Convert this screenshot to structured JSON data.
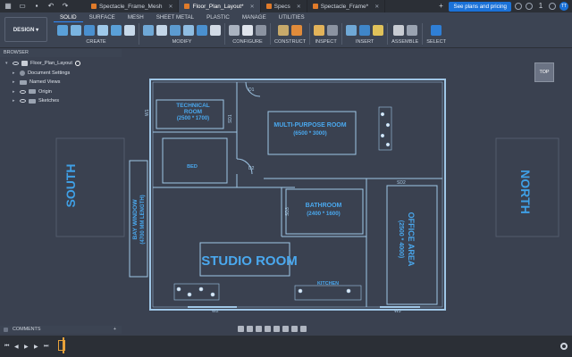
{
  "titlebar": {
    "tabs": [
      {
        "label": "Spectacle_Frame_Mesh",
        "active": false
      },
      {
        "label": "Floor_Plan_Layout*",
        "active": true
      },
      {
        "label": "Specs",
        "active": false
      },
      {
        "label": "Spectacle_Frame*",
        "active": false
      }
    ],
    "plans_button": "See plans and pricing",
    "notification_count": "1",
    "user_initials": "TT"
  },
  "toolbar": {
    "workspace": "DESIGN",
    "tabs": [
      "SOLID",
      "SURFACE",
      "MESH",
      "SHEET METAL",
      "PLASTIC",
      "MANAGE",
      "UTILITIES"
    ],
    "active_tab": "SOLID",
    "groups": [
      "CREATE",
      "MODIFY",
      "CONFIGURE",
      "CONSTRUCT",
      "INSPECT",
      "INSERT",
      "ASSEMBLE",
      "SELECT"
    ]
  },
  "browser": {
    "header": "BROWSER",
    "root": "Floor_Plan_Layout",
    "items": [
      {
        "label": "Document Settings",
        "icon": "gear-icon"
      },
      {
        "label": "Named Views",
        "icon": "folder-icon"
      },
      {
        "label": "Origin",
        "icon": "folder-icon"
      },
      {
        "label": "Sketches",
        "icon": "folder-icon"
      }
    ]
  },
  "comments": {
    "label": "COMMENTS"
  },
  "viewcube": {
    "label": "TOP"
  },
  "plan": {
    "south": "SOUTH",
    "north": "NORTH",
    "bay_window": [
      "BAY WINDOW",
      "(4700 MM LENGTH)"
    ],
    "technical_room": [
      "TECHNICAL",
      "ROOM",
      "(2500 * 1700)"
    ],
    "multi_purpose": [
      "MULTI-PURPOSE ROOM",
      "(6500 * 3000)"
    ],
    "bed": "BED",
    "bathroom": [
      "BATHROOM",
      "(2400 * 1600)"
    ],
    "office": [
      "OFFICE AREA",
      "(2500 * 4000)"
    ],
    "studio": "STUDIO ROOM",
    "kitchen": "KITCHEN",
    "tags": {
      "d1": "D1",
      "d2": "D2",
      "sd1": "SD1",
      "sd2": "SD2",
      "sd3": "SD3",
      "w1": "W1",
      "w2": "W2",
      "w3": "W3"
    }
  },
  "colors": {
    "accent": "#1b72d8",
    "plan_line": "#9fc6e6",
    "plan_label": "#4aa8ee",
    "canvas": "#3a4150"
  }
}
